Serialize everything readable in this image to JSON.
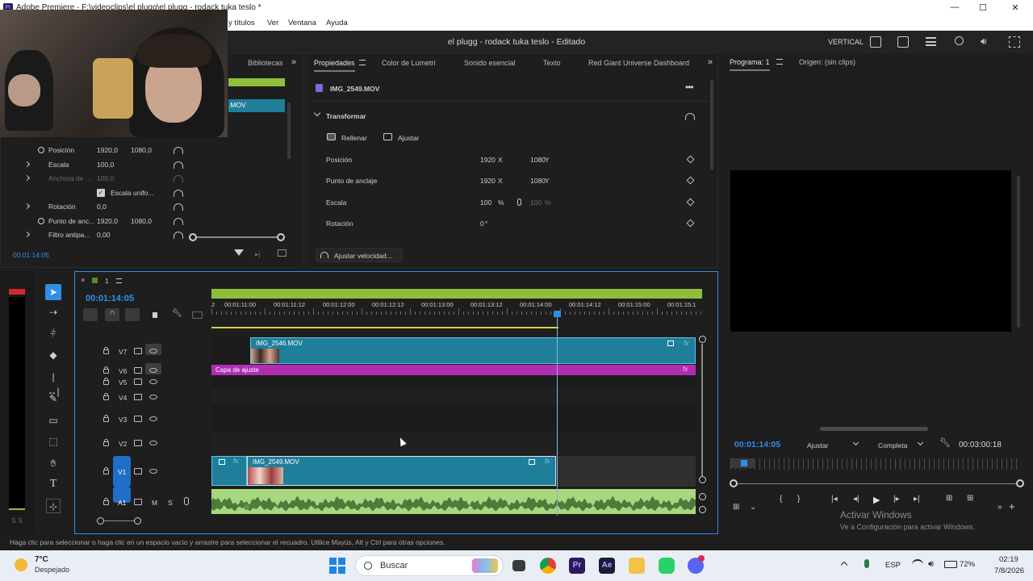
{
  "window": {
    "title": "Adobe Premiere - F:\\videoclips\\el plugg\\el plugg - rodack tuka teslo *",
    "minimize": "—",
    "maximize": "☐",
    "close": "✕"
  },
  "menu": [
    "y títulos",
    "Ver",
    "Ventana",
    "Ayuda"
  ],
  "header": {
    "project_title": "el plugg - rodack tuka teslo - Editado",
    "mode": "VERTICAL"
  },
  "left_panel": {
    "tab": "Bibliotecas",
    "clip_name": ".MOV",
    "props": [
      {
        "name": "Posición",
        "v1": "1920,0",
        "v2": "1080,0",
        "expander": false
      },
      {
        "name": "Escala",
        "v1": "100,0",
        "v2": "",
        "expander": true
      },
      {
        "name": "Anchura de ...",
        "v1": "100,0",
        "v2": "",
        "expander": true,
        "disabled": true
      },
      {
        "name": "Escala unifo...",
        "v1": "",
        "v2": "",
        "expander": false,
        "checkbox": true
      },
      {
        "name": "Rotación",
        "v1": "0,0",
        "v2": "",
        "expander": true
      },
      {
        "name": "Punto de anc...",
        "v1": "1920,0",
        "v2": "1080,0",
        "expander": false
      },
      {
        "name": "Filtro antipa...",
        "v1": "0,00",
        "v2": "",
        "expander": true
      }
    ],
    "timecode": "00:01:14:05"
  },
  "props_panel": {
    "tabs": [
      "Propiedades",
      "Color de Lumetri",
      "Sonido esencial",
      "Texto",
      "Red Giant Universe Dashboard"
    ],
    "clip": "IMG_2549.MOV",
    "section": "Transformar",
    "fill_label": "Rellenar",
    "fit_label": "Ajustar",
    "rows": [
      {
        "name": "Posición",
        "a": "1920",
        "a_unit": "X",
        "b": "1080",
        "b_unit": "Y"
      },
      {
        "name": "Punto de anclaje",
        "a": "1920",
        "a_unit": "X",
        "b": "1080",
        "b_unit": "Y"
      },
      {
        "name": "Escala",
        "a": "100",
        "a_unit": "%",
        "b": "100",
        "b_unit": "%"
      },
      {
        "name": "Rotación",
        "a": "0",
        "a_unit": "°",
        "b": "",
        "b_unit": ""
      }
    ],
    "speed_button": "Ajustar velocidad..."
  },
  "program": {
    "tab": "Programa: 1",
    "source": "Origen: (sin clips)",
    "timecode": "00:01:14:05",
    "fit": "Ajustar",
    "quality": "Completa",
    "duration": "00:03:00:18"
  },
  "timeline": {
    "sequence": "1",
    "timecode": "00:01:14:05",
    "ruler": [
      "00:01:11:00",
      "00:01:11:12",
      "00:01:12:00",
      "00:01:12:12",
      "00:01:13:00",
      "00:01:13:12",
      "00:01:14:00",
      "00:01:14:12",
      "00:01:15:00",
      "00:01:15:1"
    ],
    "ruler_start": "2",
    "tracks": [
      "V7",
      "V6",
      "V5",
      "V4",
      "V3",
      "V2",
      "V1",
      "A1"
    ],
    "clip_v7": "IMG_2546.MOV",
    "clip_v6": "Capa de ajuste",
    "clip_v1": "IMG_2549.MOV",
    "fx": "fx",
    "audio_m": "M",
    "audio_s": "S",
    "meter_label": "S S"
  },
  "status": "Haga clic para seleccionar o haga clic en un espacio vacío y arrastre para seleccionar el recuadro. Utilice Mayús, Alt y Ctrl para otras opciones.",
  "watermark": {
    "title": "Activar Windows",
    "subtitle": "Ve a Configuración para activar Windows."
  },
  "taskbar": {
    "temp": "7°C",
    "weather": "Despejado",
    "search": "Buscar",
    "lang": "ESP",
    "battery": "72%",
    "time": "02:19",
    "date": "7/8/2026"
  },
  "colors": {
    "accent": "#2f8fe8",
    "clip": "#1f7f9b",
    "adjust": "#b12db1",
    "audio": "#b5e28b",
    "ruler_green": "#8fbf3a"
  }
}
